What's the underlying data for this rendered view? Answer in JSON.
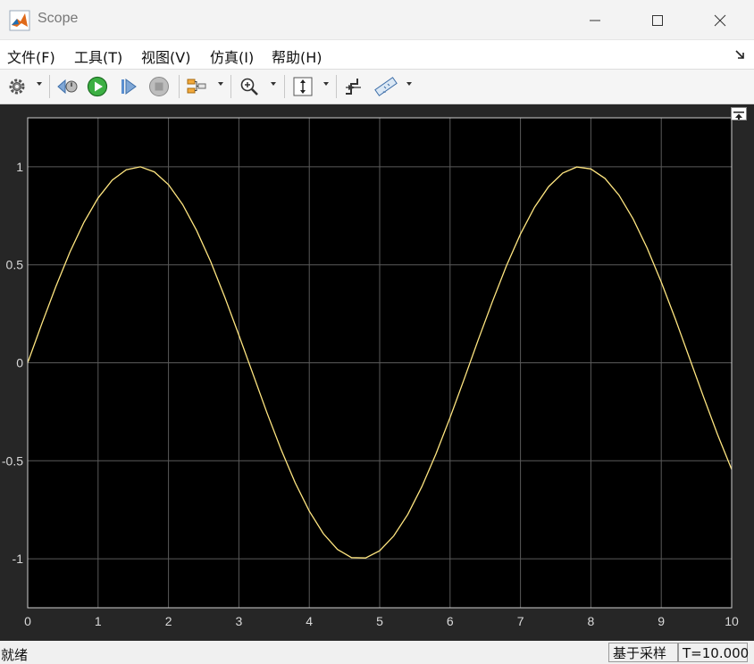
{
  "window": {
    "title": "Scope",
    "icon": "matlab-icon",
    "controls": [
      "minimize-icon",
      "maximize-icon",
      "close-icon"
    ]
  },
  "menu": {
    "items": [
      {
        "label": "文件(F)"
      },
      {
        "label": "工具(T)"
      },
      {
        "label": "视图(V)"
      },
      {
        "label": "仿真(I)"
      },
      {
        "label": "帮助(H)"
      }
    ],
    "dock_icon": "undock-arrow-icon"
  },
  "toolbar": {
    "icons": [
      "settings-gear-icon",
      "step-back-icon",
      "run-icon",
      "step-forward-icon",
      "stop-icon",
      "signal-highlight-icon",
      "zoom-in-icon",
      "scale-axes-icon",
      "triggers-icon",
      "measurements-icon"
    ]
  },
  "chart_data": {
    "type": "line",
    "title": "",
    "xlabel": "",
    "ylabel": "",
    "xlim": [
      0,
      10
    ],
    "ylim": [
      -1.25,
      1.25
    ],
    "grid": true,
    "x_ticks": [
      "0",
      "1",
      "2",
      "3",
      "4",
      "5",
      "6",
      "7",
      "8",
      "9",
      "10"
    ],
    "y_ticks": [
      "1",
      "0.5",
      "0",
      "-0.5",
      "-1"
    ],
    "y_tick_values": [
      1,
      0.5,
      0,
      -0.5,
      -1
    ],
    "series": [
      {
        "color": "#ffe680",
        "x": [
          0,
          0.2,
          0.4,
          0.6,
          0.8,
          1.0,
          1.2,
          1.4,
          1.6,
          1.8,
          2.0,
          2.2,
          2.4,
          2.6,
          2.8,
          3.0,
          3.2,
          3.4,
          3.6,
          3.8,
          4.0,
          4.2,
          4.4,
          4.6,
          4.8,
          5.0,
          5.2,
          5.4,
          5.6,
          5.8,
          6.0,
          6.2,
          6.4,
          6.6,
          6.8,
          7.0,
          7.2,
          7.4,
          7.6,
          7.8,
          8.0,
          8.2,
          8.4,
          8.6,
          8.8,
          9.0,
          9.2,
          9.4,
          9.6,
          9.8,
          10.0
        ],
        "y": [
          0,
          0.199,
          0.389,
          0.565,
          0.717,
          0.841,
          0.932,
          0.985,
          1.0,
          0.974,
          0.909,
          0.808,
          0.675,
          0.516,
          0.335,
          0.141,
          -0.058,
          -0.256,
          -0.443,
          -0.612,
          -0.757,
          -0.872,
          -0.952,
          -0.994,
          -0.996,
          -0.959,
          -0.883,
          -0.773,
          -0.631,
          -0.465,
          -0.279,
          -0.083,
          0.117,
          0.311,
          0.494,
          0.657,
          0.794,
          0.899,
          0.968,
          0.999,
          0.989,
          0.941,
          0.855,
          0.734,
          0.585,
          0.412,
          0.223,
          0.025,
          -0.174,
          -0.366,
          -0.544
        ]
      }
    ]
  },
  "plot": {
    "restore_icon": "expand-panel-icon"
  },
  "status": {
    "left": "就绪",
    "mode": "基于采样",
    "time": "T=10.000"
  }
}
